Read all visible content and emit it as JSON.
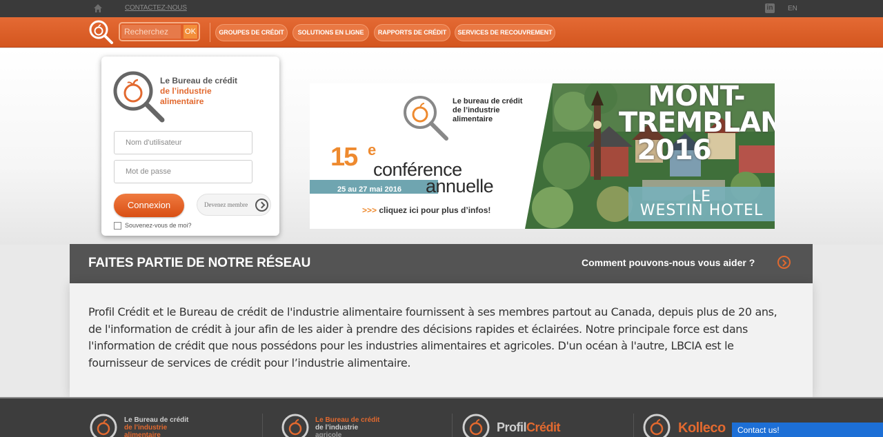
{
  "topbar": {
    "contact_link": "CONTACTEZ-NOUS",
    "lang": "EN",
    "linkedin_glyph": "in"
  },
  "nav": {
    "search_placeholder": "Recherchez",
    "search_ok": "OK",
    "items": [
      {
        "label": "GROUPES DE CRÉDIT"
      },
      {
        "label": "SOLUTIONS EN LIGNE"
      },
      {
        "label": "RAPPORTS DE CRÉDIT"
      },
      {
        "label": "SERVICES DE RECOUVREMENT"
      }
    ]
  },
  "login": {
    "logo_line1": "Le Bureau de crédit",
    "logo_line2": "de l’industrie",
    "logo_line3": "alimentaire",
    "username_placeholder": "Nom d'utilisateur",
    "password_placeholder": "Mot de passe",
    "connexion_label": "Connexion",
    "member_label": "Devenez membre",
    "remember_label": "Souvenez-vous de moi?"
  },
  "banner": {
    "logo_line1": "Le bureau de crédit",
    "logo_line2": "de l’industrie",
    "logo_line3": "alimentaire",
    "ordinal_num": "15",
    "ordinal_sup": "e",
    "conference": "conférence",
    "annuelle": "annuelle",
    "dates": "25 au 27 mai 2016",
    "cta_arrows": ">>>",
    "cta": "cliquez ici pour plus d’infos!",
    "place_line1": "MONT-",
    "place_line2": "TREMBLANT",
    "year": "2016",
    "hotel_line1": "LE",
    "hotel_line2": "WESTIN HOTEL"
  },
  "network": {
    "title": "FAITES PARTIE DE NOTRE RÉSEAU",
    "help": "Comment pouvons-nous vous aider ?",
    "body": "Profil Crédit et le Bureau de crédit de l'industrie alimentaire fournissent à ses membres partout au Canada, depuis plus de 20 ans, de l'information de crédit à jour afin de les aider à prendre des décisions rapides et éclairées. Notre principale force est dans l'information de crédit que nous possédons pour les industries alimentaires et agricoles. D'un océan à l'autre, LBCIA est le fournisseur de services de crédit pour l’industrie alimentaire."
  },
  "footer": {
    "brand1_l1": "Le Bureau de crédit",
    "brand1_l2": "de l’industrie",
    "brand1_l3": "alimentaire",
    "brand2_l1": "Le Bureau de crédit",
    "brand2_l2": "de l’industrie",
    "brand2_l3": "agricole",
    "brand3_a": "Profil",
    "brand3_b": "Crédit",
    "brand4": "Kolleco",
    "contact_us": "Contact us!"
  },
  "colors": {
    "accent_orange": "#e2692f",
    "dark_bar": "#545454",
    "chat_blue": "#1d6fd6"
  }
}
